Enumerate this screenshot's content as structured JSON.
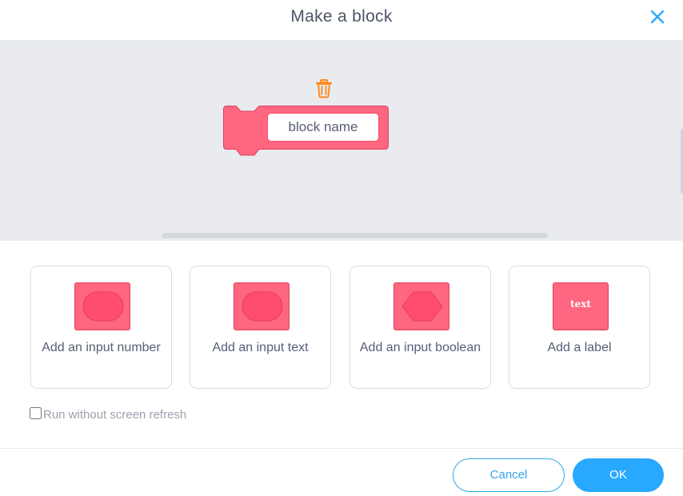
{
  "dialog": {
    "title": "Make a block",
    "close_icon": "close-icon"
  },
  "workspace": {
    "block_name_value": "block name",
    "block_color": "#ff6680",
    "trash_icon": "trash-icon",
    "trash_color": "#ff8a1e"
  },
  "options": [
    {
      "label": "Add an input number",
      "icon": "input-number-icon"
    },
    {
      "label": "Add an input text",
      "icon": "input-text-icon"
    },
    {
      "label": "Add an input boolean",
      "icon": "input-boolean-icon"
    },
    {
      "label": "Add a label",
      "icon": "label-icon",
      "icon_text": "text"
    }
  ],
  "run_without_refresh": {
    "label": "Run without screen refresh",
    "checked": false
  },
  "buttons": {
    "cancel": "Cancel",
    "ok": "OK"
  },
  "colors": {
    "accent": "#29a8ff",
    "block": "#ff6680",
    "block_border": "#e0405d"
  }
}
